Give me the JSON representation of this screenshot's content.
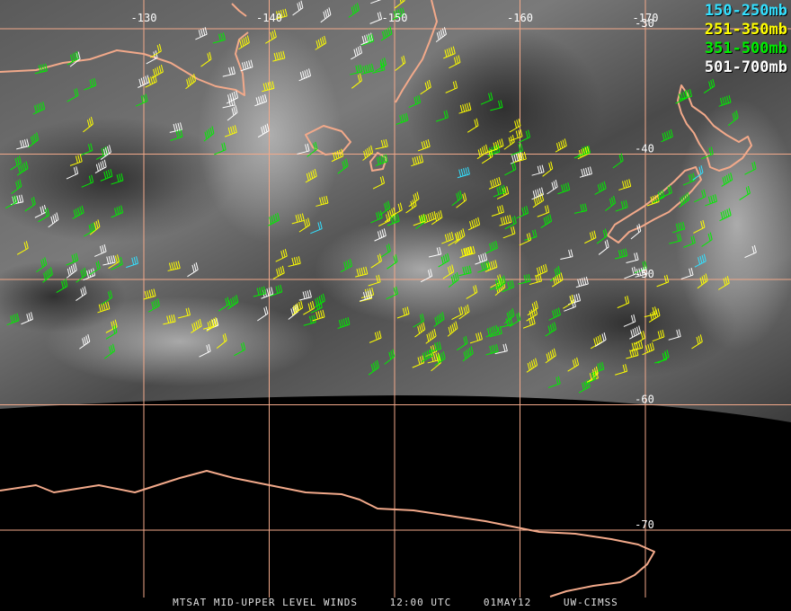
{
  "map": {
    "longitude_labels": [
      {
        "label": "-130",
        "lon": -130
      },
      {
        "label": "-140",
        "lon": -140
      },
      {
        "label": "-150",
        "lon": -150
      },
      {
        "label": "-160",
        "lon": -160
      },
      {
        "label": "-170",
        "lon": -170
      }
    ],
    "latitude_labels": [
      {
        "label": "-30",
        "lat": -30
      },
      {
        "label": "-40",
        "lat": -40
      },
      {
        "label": "-50",
        "lat": -50
      },
      {
        "label": "-60",
        "lat": -60
      },
      {
        "label": "-70",
        "lat": -70
      }
    ],
    "grid_color": "#f2a98a",
    "coast_color": "#f2a98a",
    "background_imagery": "water-vapor satellite imagery, grayscale",
    "earth_edge_lat": -58.5
  },
  "legend": [
    {
      "label": "150-250mb",
      "color": "#33e0ff"
    },
    {
      "label": "251-350mb",
      "color": "#ffff00"
    },
    {
      "label": "351-500mb",
      "color": "#00ee00"
    },
    {
      "label": "501-700mb",
      "color": "#ffffff"
    }
  ],
  "footer": {
    "product": "MTSAT MID-UPPER LEVEL WINDS",
    "time": "12:00 UTC",
    "date": "01MAY12",
    "source": "UW-CIMSS"
  }
}
